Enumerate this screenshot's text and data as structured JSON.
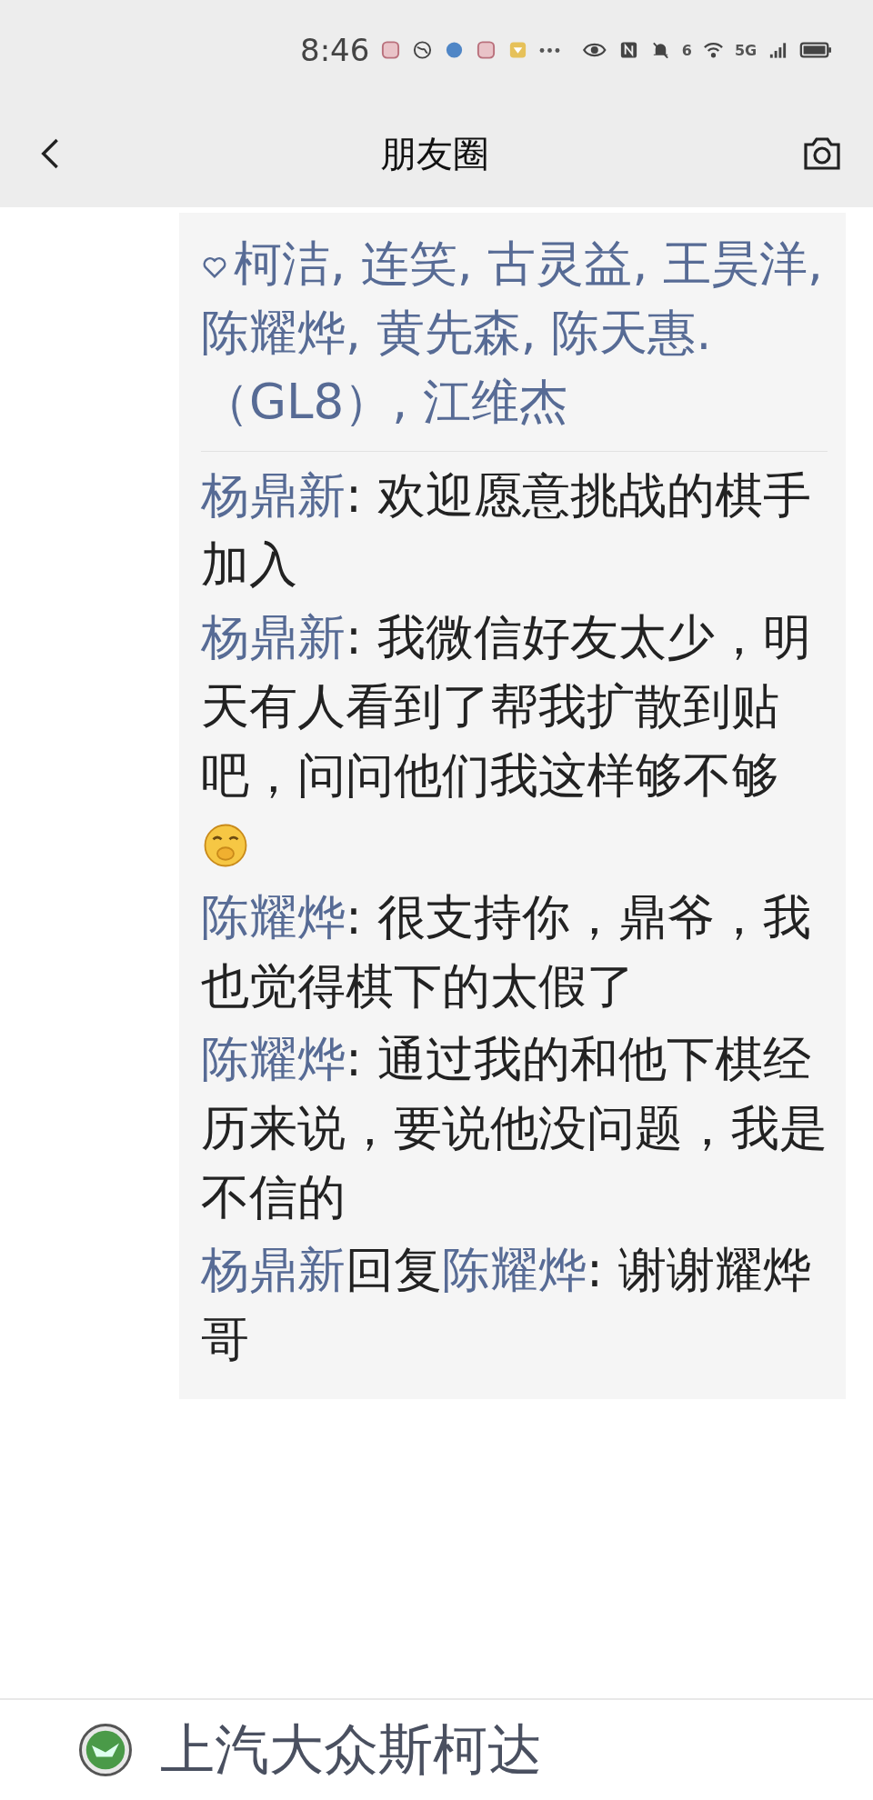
{
  "status_bar": {
    "time": "8:46",
    "wifi_label": "6",
    "network": "5G"
  },
  "header": {
    "title": "朋友圈"
  },
  "likes": {
    "names": "柯洁, 连笑, 古灵益, 王昊洋, 陈耀烨, 黄先森, 陈天惠.（GL8）, 江维杰"
  },
  "comments": [
    {
      "author": "杨鼎新",
      "text": ": 欢迎愿意挑战的棋手加入",
      "emoji": false
    },
    {
      "author": "杨鼎新",
      "text": ": 我微信好友太少，明天有人看到了帮我扩散到贴吧，问问他们我这样够不够",
      "emoji": true
    },
    {
      "author": "陈耀烨",
      "text": ": 很支持你，鼎爷，我也觉得棋下的太假了",
      "emoji": false
    },
    {
      "author": "陈耀烨",
      "text": ": 通过我的和他下棋经历来说，要说他没问题，我是不信的",
      "emoji": false
    },
    {
      "author": "杨鼎新",
      "reply_word": "回复",
      "reply_to": "陈耀烨",
      "text": ": 谢谢耀烨哥",
      "emoji": false
    }
  ],
  "ad": {
    "advertiser": "上汽大众斯柯达"
  }
}
